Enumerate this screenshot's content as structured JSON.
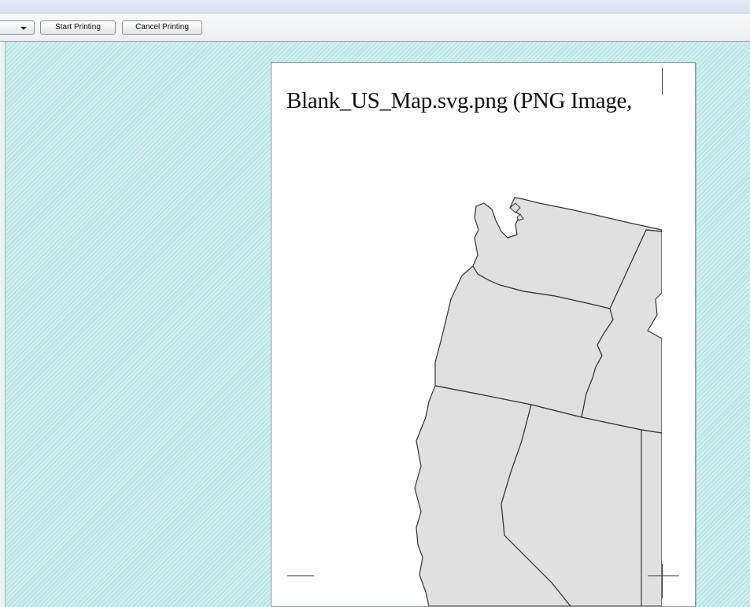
{
  "toolbar": {
    "start_printing_label": "Start Printing",
    "cancel_printing_label": "Cancel Printing",
    "dropdown_icon": "chevron-down-icon"
  },
  "preview": {
    "page_title": "Blank_US_Map.svg.png (PNG Image,",
    "map": {
      "fill_color": "#e0e0e0",
      "stroke_color": "#333333",
      "background_color": "#c4eaea"
    }
  }
}
